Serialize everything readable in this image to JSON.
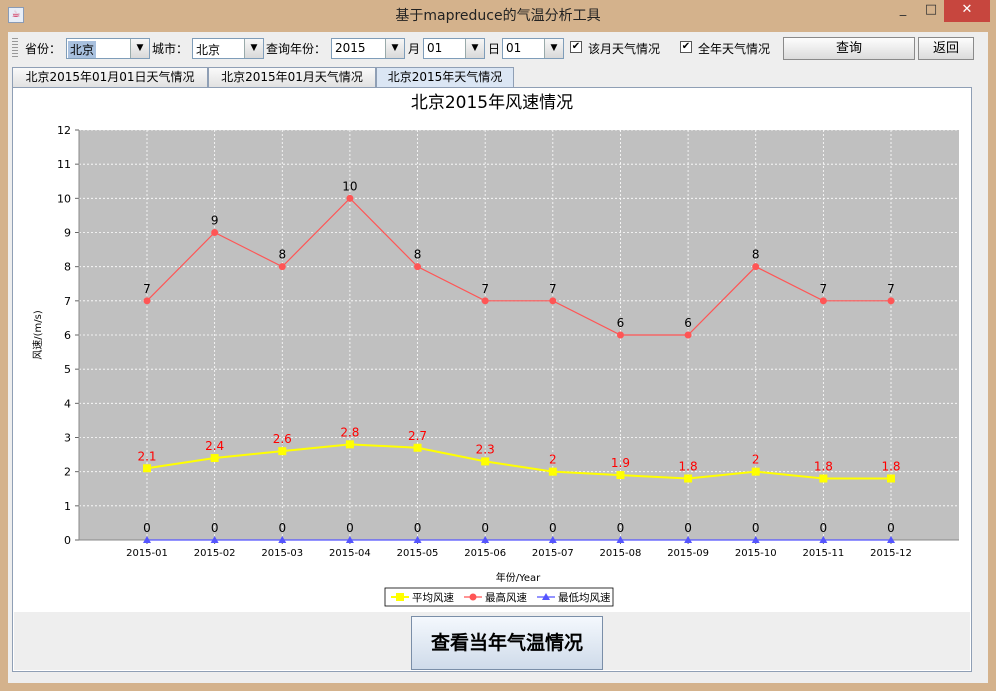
{
  "window": {
    "title": "基于mapreduce的气温分析工具",
    "min_label": "_",
    "max_label": "□",
    "close_label": "✕"
  },
  "toolbar": {
    "province_label": "省份：",
    "province_value": "北京",
    "city_label": "城市：",
    "city_value": "北京",
    "year_label": "查询年份：",
    "year_value": "2015",
    "month_label": "月",
    "month_value": "01",
    "day_label": "日",
    "day_value": "01",
    "month_weather_label": "该月天气情况",
    "year_weather_label": "全年天气情况",
    "query_button": "查询",
    "back_button": "返回"
  },
  "tabs": [
    {
      "label": "北京2015年01月01日天气情况",
      "active": false
    },
    {
      "label": "北京2015年01月天气情况",
      "active": false
    },
    {
      "label": "北京2015年天气情况",
      "active": true
    }
  ],
  "bottom_button": "查看当年气温情况",
  "chart_data": {
    "type": "line",
    "title": "北京2015年风速情况",
    "xlabel": "年份/Year",
    "ylabel": "风速/(m/s)",
    "ylim": [
      0,
      12
    ],
    "yticks": [
      0,
      1,
      2,
      3,
      4,
      5,
      6,
      7,
      8,
      9,
      10,
      11,
      12
    ],
    "grid": true,
    "legend_placement": "bottom",
    "categories": [
      "2015-01",
      "2015-02",
      "2015-03",
      "2015-04",
      "2015-05",
      "2015-06",
      "2015-07",
      "2015-08",
      "2015-09",
      "2015-10",
      "2015-11",
      "2015-12"
    ],
    "series": [
      {
        "name": "平均风速",
        "color": "#ffff00",
        "label_color": "#ff0000",
        "marker": "square",
        "values": [
          2.1,
          2.4,
          2.6,
          2.8,
          2.7,
          2.3,
          2,
          1.9,
          1.8,
          2,
          1.8,
          1.8
        ]
      },
      {
        "name": "最高风速",
        "color": "#ff5555",
        "label_color": "#000000",
        "marker": "circle",
        "values": [
          7,
          9,
          8,
          10,
          8,
          7,
          7,
          6,
          6,
          8,
          7,
          7
        ]
      },
      {
        "name": "最低均风速",
        "color": "#5555ff",
        "label_color": "#000000",
        "marker": "triangle",
        "values": [
          0,
          0,
          0,
          0,
          0,
          0,
          0,
          0,
          0,
          0,
          0,
          0
        ]
      }
    ],
    "plot_background": "#c0c0c0"
  }
}
